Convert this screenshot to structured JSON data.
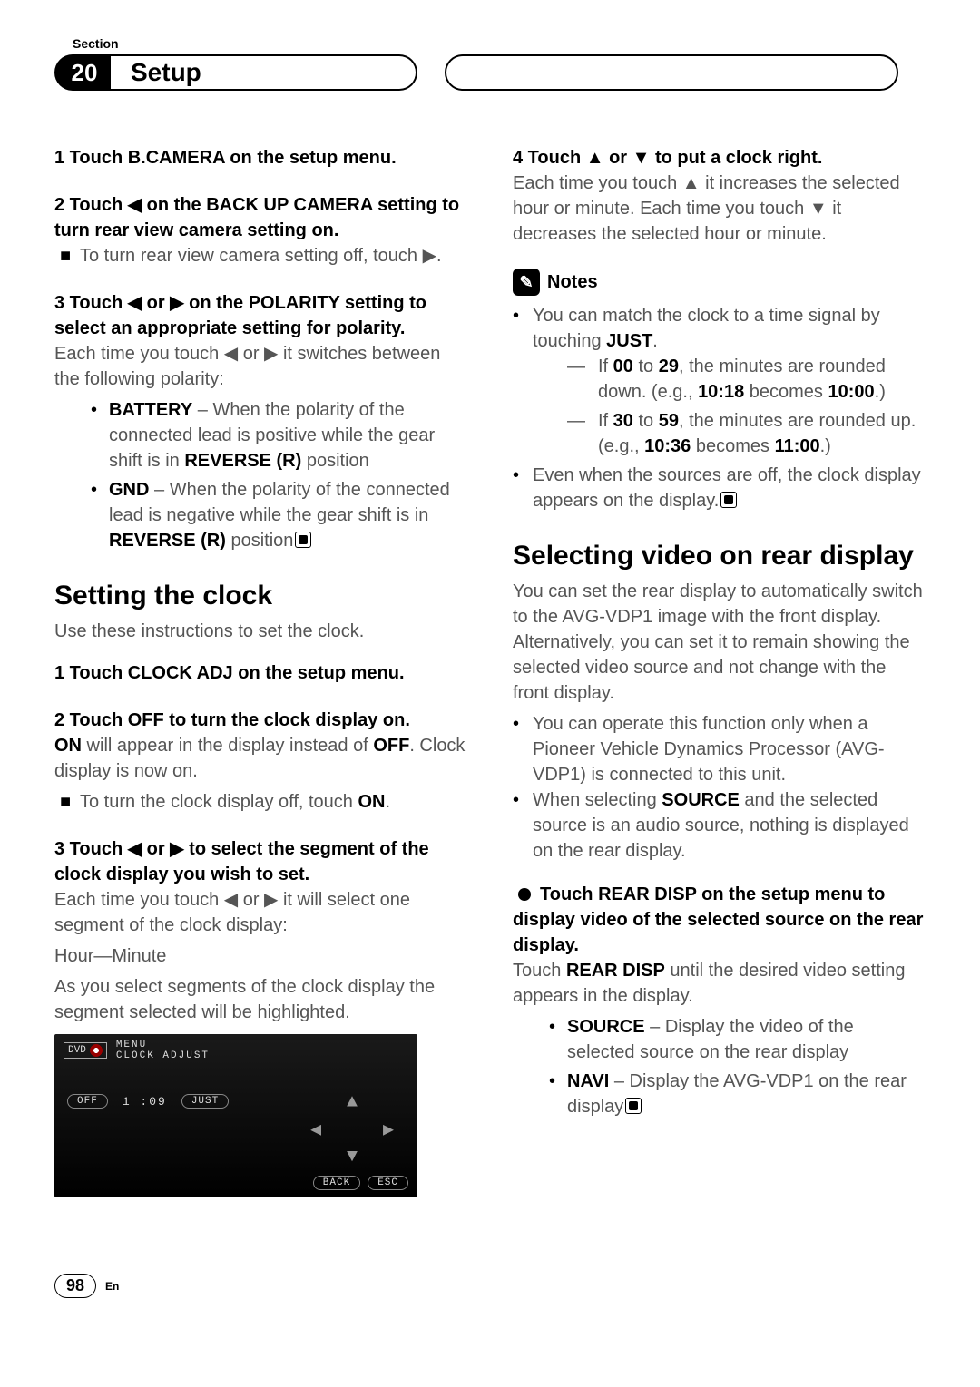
{
  "header": {
    "sectionLabel": "Section",
    "sectionNumber": "20",
    "title": "Setup"
  },
  "left": {
    "step1": "1   Touch B.CAMERA on the setup menu.",
    "step2": "2   Touch ◀ on the BACK UP CAMERA setting to turn rear view camera setting on.",
    "step2note": "To turn rear view camera setting off, touch ▶.",
    "step3": "3   Touch ◀ or ▶ on the POLARITY setting to select an appropriate setting for polarity.",
    "step3body": "Each time you touch ◀ or ▶ it switches between the following polarity:",
    "step3b1a": "BATTERY",
    "step3b1b": " – When the polarity of the connected lead is positive while the gear shift is in ",
    "step3b1c": "REVERSE (R)",
    "step3b1d": " position",
    "step3b2a": "GND",
    "step3b2b": " – When the polarity of the connected lead is negative while the gear shift is in ",
    "step3b2c": "REVERSE (R)",
    "step3b2d": " position",
    "h2a": "Setting the clock",
    "h2a_sub": "Use these instructions to set the clock.",
    "c1": "1   Touch CLOCK ADJ on the setup menu.",
    "c2": "2   Touch OFF to turn the clock display on.",
    "c2b_a": "ON",
    "c2b_b": " will appear in the display instead of ",
    "c2b_c": "OFF",
    "c2b_d": ". Clock display is now on.",
    "c2note_a": "To turn the clock display off, touch ",
    "c2note_b": "ON",
    "c2note_c": ".",
    "c3": "3   Touch ◀ or ▶ to select the segment of the clock display you wish to set.",
    "c3b": "Each time you touch ◀ or ▶ it will select one segment of the clock display:",
    "c3c": "Hour—Minute",
    "c3d": "As you select segments of the clock display the segment selected will be highlighted.",
    "ss": {
      "dvd": "DVD",
      "menu1": "MENU",
      "menu2": "CLOCK ADJUST",
      "off": "OFF",
      "time": "1 :09",
      "just": "JUST",
      "back": "BACK",
      "esc": "ESC"
    }
  },
  "right": {
    "step4": "4   Touch ▲ or ▼ to put a clock right.",
    "step4b": "Each time you touch ▲ it increases the selected hour or minute. Each time you touch ▼ it decreases the selected hour or minute.",
    "notesLabel": "Notes",
    "n1_a": "You can match the clock to a time signal by touching ",
    "n1_b": "JUST",
    "n1_c": ".",
    "n1d1_a": "If ",
    "n1d1_b": "00",
    "n1d1_c": " to ",
    "n1d1_d": "29",
    "n1d1_e": ", the minutes are rounded down. (e.g., ",
    "n1d1_f": "10:18",
    "n1d1_g": " becomes ",
    "n1d1_h": "10:00",
    "n1d1_i": ".)",
    "n1d2_a": "If ",
    "n1d2_b": "30",
    "n1d2_c": " to ",
    "n1d2_d": "59",
    "n1d2_e": ", the minutes are rounded up. (e.g., ",
    "n1d2_f": "10:36",
    "n1d2_g": " becomes ",
    "n1d2_h": "11:00",
    "n1d2_i": ".)",
    "n2": "Even when the sources are off, the clock display appears on the display.",
    "h2b": "Selecting video on rear display",
    "h2b_body": "You can set the rear display to automatically switch to the AVG-VDP1 image with the front display. Alternatively, you can set it to remain showing the selected video source and not change with the front display.",
    "rb1": "You can operate this function only when a Pioneer Vehicle Dynamics Processor (AVG-VDP1) is connected to this unit.",
    "rb2_a": "When selecting ",
    "rb2_b": "SOURCE",
    "rb2_c": " and the selected source is an audio source, nothing is displayed on the rear display.",
    "rstep": "Touch REAR DISP on the setup menu to display video of the selected source on the rear display.",
    "rstep_b_a": "Touch ",
    "rstep_b_b": "REAR DISP",
    "rstep_b_c": " until the desired video setting appears in the display.",
    "rsb1_a": "SOURCE",
    "rsb1_b": " – Display the video of the selected source on the rear display",
    "rsb2_a": "NAVI",
    "rsb2_b": " – Display the AVG-VDP1 on the rear display"
  },
  "footer": {
    "page": "98",
    "lang": "En"
  }
}
